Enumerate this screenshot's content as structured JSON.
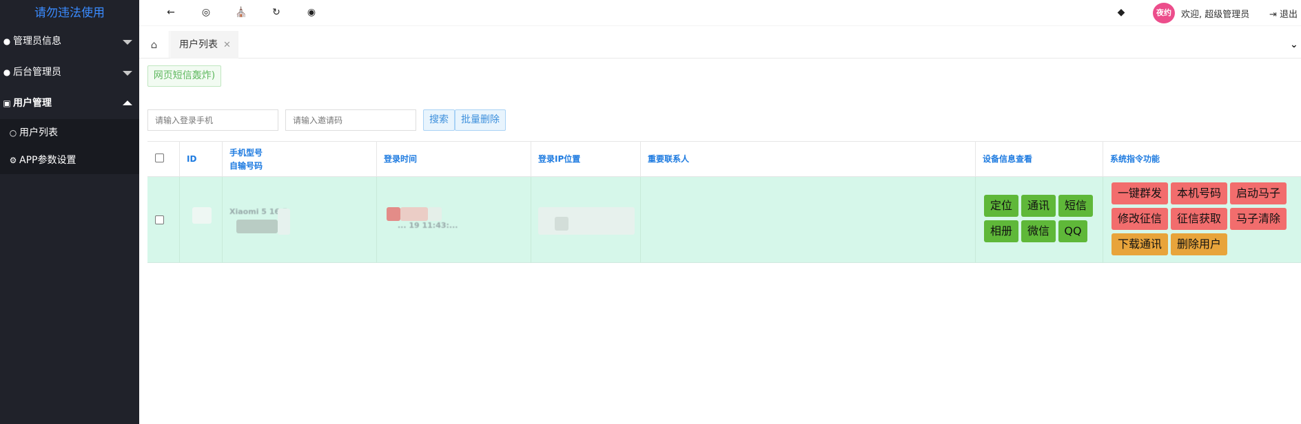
{
  "brand": {
    "title": "请勿违法使用",
    "color": "#3a8bff"
  },
  "sidebar": {
    "items": [
      {
        "label": "管理员信息",
        "icon": "user-icon",
        "expanded": false
      },
      {
        "label": "后台管理员",
        "icon": "user-icon",
        "expanded": false
      },
      {
        "label": "用户管理",
        "icon": "id-card-icon",
        "expanded": true
      }
    ],
    "subitems": [
      {
        "label": "用户列表",
        "icon": "user-outline-icon"
      },
      {
        "label": "APP参数设置",
        "icon": "gear-icon"
      }
    ]
  },
  "header": {
    "icons": [
      "arrow-left-icon",
      "lifebuoy-icon",
      "bank-icon",
      "refresh-icon",
      "globe-icon",
      "tag-icon"
    ],
    "avatar_text": "夜约",
    "welcome": "欢迎, 超级管理员",
    "logout": "退出"
  },
  "tabs": {
    "items": [
      {
        "label": "用户列表",
        "close": "✕"
      }
    ]
  },
  "content": {
    "notice_button": "网页短信轰炸)",
    "search": {
      "phone_placeholder": "请输入登录手机",
      "invite_placeholder": "请输入邀请码",
      "search_label": "搜索",
      "batch_delete_label": "批量删除"
    },
    "table": {
      "headers": {
        "id": "ID",
        "phone_model": "手机型号",
        "own_number": "自输号码",
        "login_time": "登录时间",
        "login_ip": "登录IP位置",
        "contacts": "重要联系人",
        "device_info": "设备信息查看",
        "system_cmds": "系统指令功能"
      },
      "rows": [
        {
          "model_text": "Xiaomi 5 16 5",
          "time_text": "... 19 11:43:...",
          "device_buttons": [
            "定位",
            "通讯",
            "短信",
            "相册",
            "微信",
            "QQ"
          ],
          "cmd_buttons": [
            "一键群发",
            "本机号码",
            "启动马子",
            "修改征信",
            "征信获取",
            "马子清除"
          ],
          "cmd_buttons_orange": [
            "下载通讯",
            "删除用户"
          ]
        }
      ]
    }
  },
  "colors": {
    "sidebar_bg": "#20222a",
    "row_bg": "#d6f7ea",
    "green_button": "#5fb839",
    "red_button": "#f26d6d",
    "orange_button": "#e8a43b",
    "header_text": "#1e7be0"
  }
}
